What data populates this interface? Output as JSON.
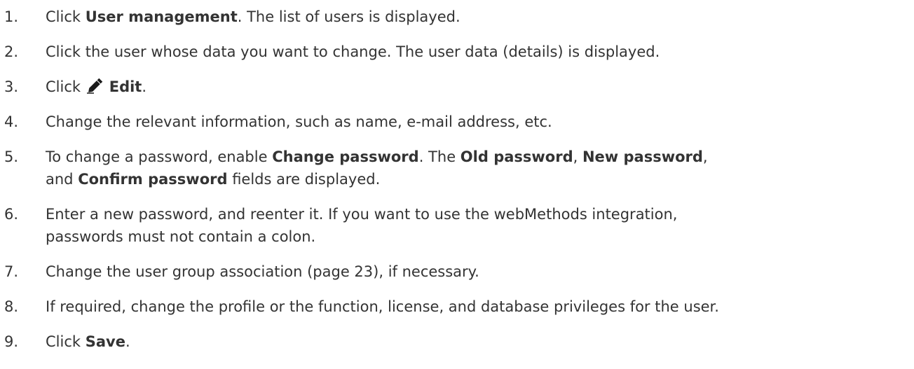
{
  "steps": [
    {
      "num": "1.",
      "parts": [
        "Click ",
        "User management",
        ". The list of users is displayed."
      ]
    },
    {
      "num": "2.",
      "text": "Click the user whose data you want to change. The user data (details) is displayed."
    },
    {
      "num": "3.",
      "parts": [
        "Click ",
        "Edit",
        "."
      ],
      "icon": "pencil-icon"
    },
    {
      "num": "4.",
      "text": "Change the relevant information, such as name, e-mail address, etc."
    },
    {
      "num": "5.",
      "parts": [
        "To change a password, enable ",
        "Change password",
        ". The ",
        "Old password",
        ", ",
        "New password",
        ","
      ],
      "line2_parts": [
        "and ",
        "Confirm password",
        " fields are displayed."
      ]
    },
    {
      "num": "6.",
      "text": "Enter a new password, and reenter it. If you want to use the webMethods integration,",
      "line2": "passwords must not contain a colon."
    },
    {
      "num": "7.",
      "text": "Change the user group association (page 23), if necessary."
    },
    {
      "num": "8.",
      "text": "If required, change the profile or the function, license, and database privileges for the user."
    },
    {
      "num": "9.",
      "parts": [
        "Click ",
        "Save",
        "."
      ]
    }
  ]
}
